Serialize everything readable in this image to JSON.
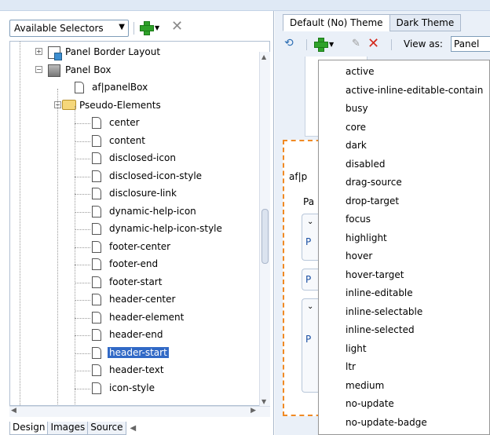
{
  "left": {
    "selector_dropdown": "Available Selectors",
    "tree": [
      {
        "label": "Panel Border Layout",
        "level": 1,
        "icon": "layout-icon",
        "expander": "+"
      },
      {
        "label": "Panel Box",
        "level": 1,
        "icon": "box-icon",
        "expander": "-"
      },
      {
        "label": "af|panelBox",
        "level": 2,
        "icon": "page-icon"
      },
      {
        "label": "Pseudo-Elements",
        "level": 2,
        "icon": "folder-icon",
        "expander": "-"
      },
      {
        "label": "center",
        "level": 3,
        "icon": "page-icon"
      },
      {
        "label": "content",
        "level": 3,
        "icon": "page-icon"
      },
      {
        "label": "disclosed-icon",
        "level": 3,
        "icon": "page-icon"
      },
      {
        "label": "disclosed-icon-style",
        "level": 3,
        "icon": "page-icon"
      },
      {
        "label": "disclosure-link",
        "level": 3,
        "icon": "page-icon"
      },
      {
        "label": "dynamic-help-icon",
        "level": 3,
        "icon": "page-icon"
      },
      {
        "label": "dynamic-help-icon-style",
        "level": 3,
        "icon": "page-icon"
      },
      {
        "label": "footer-center",
        "level": 3,
        "icon": "page-icon"
      },
      {
        "label": "footer-end",
        "level": 3,
        "icon": "page-icon"
      },
      {
        "label": "footer-start",
        "level": 3,
        "icon": "page-icon"
      },
      {
        "label": "header-center",
        "level": 3,
        "icon": "page-icon"
      },
      {
        "label": "header-element",
        "level": 3,
        "icon": "page-icon"
      },
      {
        "label": "header-end",
        "level": 3,
        "icon": "page-icon"
      },
      {
        "label": "header-start",
        "level": 3,
        "icon": "page-icon",
        "selected": true
      },
      {
        "label": "header-text",
        "level": 3,
        "icon": "page-icon"
      },
      {
        "label": "icon-style",
        "level": 3,
        "icon": "page-icon"
      }
    ],
    "bottom_tabs": [
      "Design",
      "Images",
      "Source"
    ],
    "active_bottom_tab": "Design"
  },
  "right": {
    "tabs": [
      "Default (No) Theme",
      "Dark Theme"
    ],
    "active_tab": "Default (No) Theme",
    "view_as_label": "View as:",
    "view_as_value": "Panel",
    "preview_texts": [
      "af|p",
      "Pa",
      "P",
      "P",
      "P"
    ]
  },
  "pseudo_class_menu": [
    "active",
    "active-inline-editable-contain",
    "busy",
    "core",
    "dark",
    "disabled",
    "drag-source",
    "drop-target",
    "focus",
    "highlight",
    "hover",
    "hover-target",
    "inline-editable",
    "inline-selectable",
    "inline-selected",
    "light",
    "ltr",
    "medium",
    "no-update",
    "no-update-badge"
  ],
  "colors": {
    "selection": "#3169c6",
    "add_green": "#2fa22a",
    "delete_red": "#d42b1e",
    "preview_border": "#f08a24"
  }
}
